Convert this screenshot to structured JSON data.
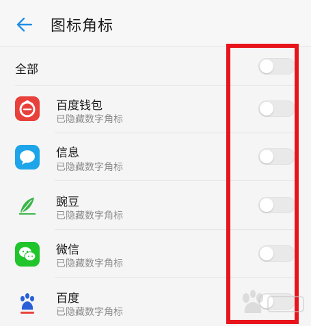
{
  "header": {
    "title": "图标角标",
    "back_icon": "arrow-left-icon"
  },
  "all_row": {
    "label": "全部",
    "toggle_on": false
  },
  "apps": [
    {
      "name": "百度钱包",
      "status": "已隐藏数字角标",
      "icon": "baidu-wallet-icon",
      "toggle_on": false
    },
    {
      "name": "信息",
      "status": "已隐藏数字角标",
      "icon": "messages-icon",
      "toggle_on": false
    },
    {
      "name": "豌豆",
      "status": "已隐藏数字角标",
      "icon": "wandoujia-icon",
      "toggle_on": false
    },
    {
      "name": "微信",
      "status": "已隐藏数字角标",
      "icon": "wechat-icon",
      "toggle_on": false
    },
    {
      "name": "百度",
      "status": "已隐藏数字角标",
      "icon": "baidu-icon",
      "toggle_on": false
    }
  ],
  "colors": {
    "accent": "#1e8ee8",
    "highlight": "#e8141c",
    "wallet": "#e8403a",
    "messages": "#1ea4e8",
    "wechat": "#20c42b",
    "baidu": "#2a5fd8"
  }
}
